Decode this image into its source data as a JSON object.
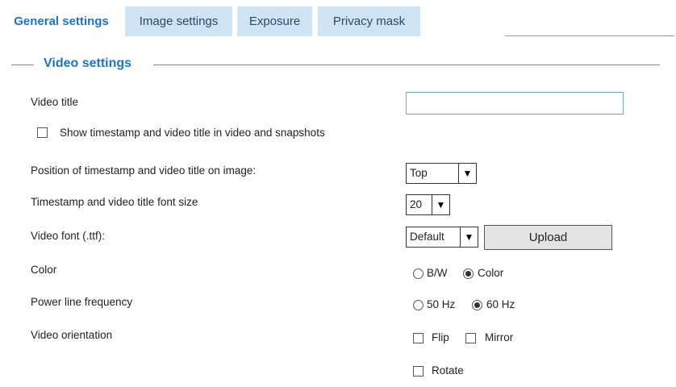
{
  "tabs": {
    "active": "General settings",
    "others": [
      "Image settings",
      "Exposure",
      "Privacy mask"
    ]
  },
  "section": {
    "title": "Video settings"
  },
  "video_title": {
    "label": "Video title",
    "value": ""
  },
  "timestamp_checkbox": {
    "label": "Show timestamp and video title in video and snapshots",
    "checked": false
  },
  "position": {
    "label": "Position of timestamp and video title on image:",
    "value": "Top"
  },
  "font_size": {
    "label": "Timestamp and video title font size",
    "value": "20"
  },
  "font": {
    "label": "Video font (.ttf):",
    "value": "Default",
    "upload_label": "Upload"
  },
  "color": {
    "label": "Color",
    "options": [
      "B/W",
      "Color"
    ],
    "selected": "Color"
  },
  "power": {
    "label": "Power line frequency",
    "options": [
      "50 Hz",
      "60 Hz"
    ],
    "selected": "60 Hz"
  },
  "orientation": {
    "label": "Video orientation",
    "flip": "Flip",
    "mirror": "Mirror",
    "rotate": "Rotate"
  }
}
